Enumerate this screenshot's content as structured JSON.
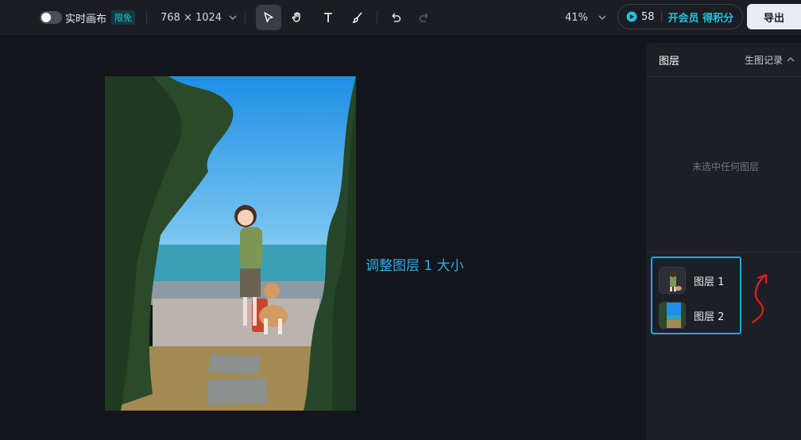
{
  "toolbar": {
    "realtime_canvas_label": "实时画布",
    "free_badge": "限免",
    "canvas_size": "768 × 1024",
    "zoom": "41%",
    "credits": "58",
    "vip_label": "开会员 得积分",
    "export_label": "导出",
    "tools": [
      "select-icon",
      "hand-icon",
      "text-icon",
      "brush-icon",
      "undo-icon",
      "redo-icon"
    ]
  },
  "canvas": {
    "annotation": "调整图层 1 大小"
  },
  "panel": {
    "title": "图层",
    "history_label": "生图记录",
    "empty_text": "未选中任何图层",
    "layers": [
      {
        "name": "图层 1"
      },
      {
        "name": "图层 2"
      }
    ]
  },
  "colors": {
    "accent": "#18a9e9",
    "annotation_arrow": "#e02020",
    "background": "#14151a"
  }
}
